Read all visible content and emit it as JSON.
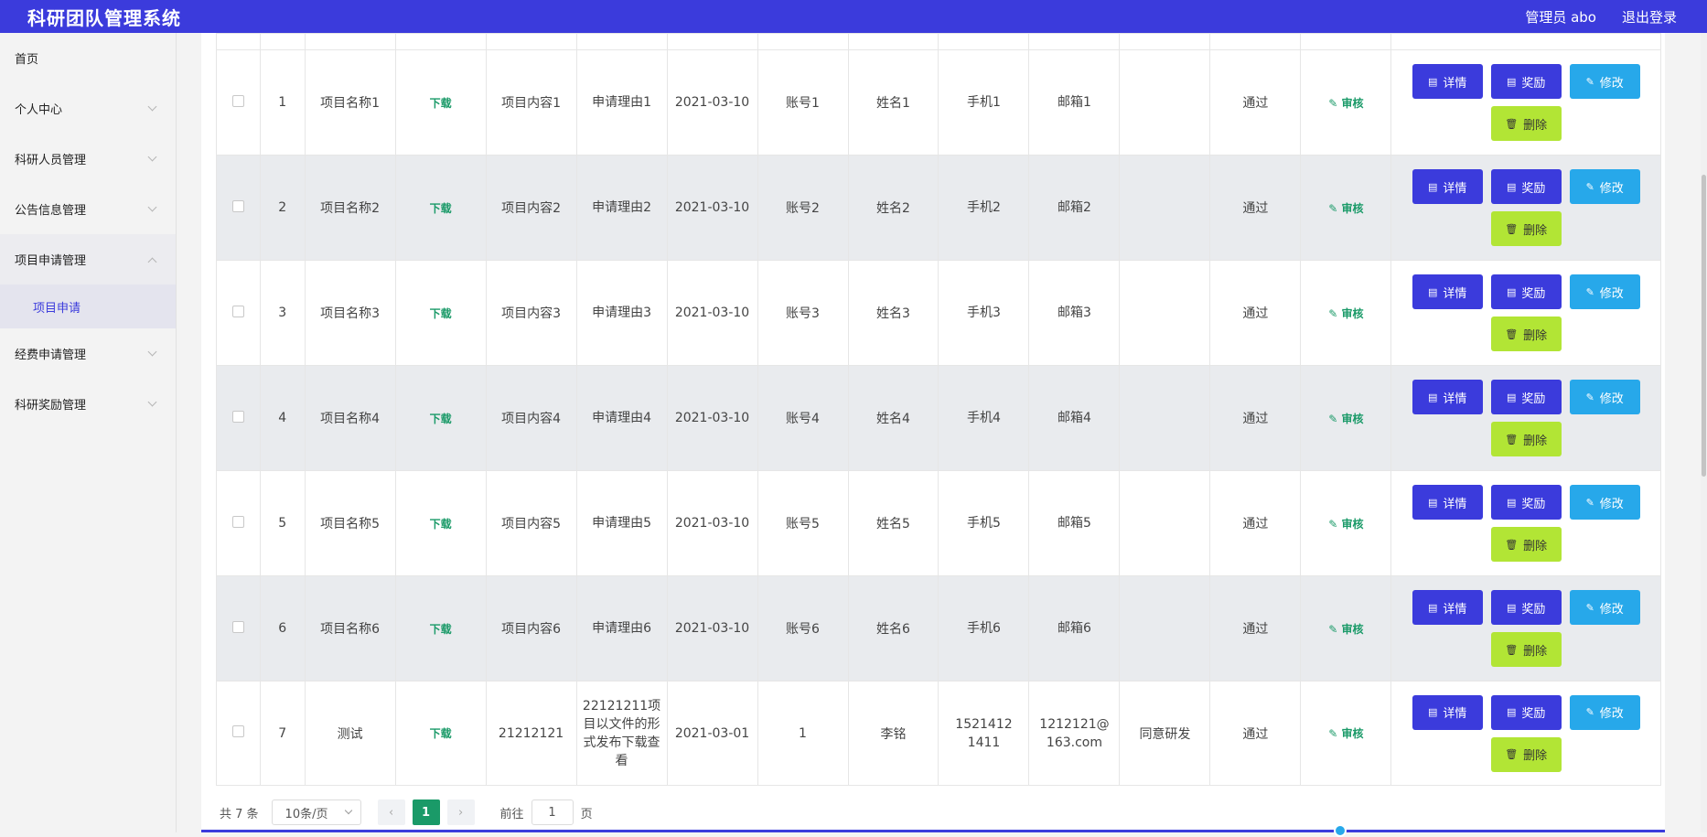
{
  "header": {
    "title": "科研团队管理系统",
    "user": "管理员 abo",
    "logout": "退出登录"
  },
  "sidebar": {
    "items": [
      {
        "label": "首页"
      },
      {
        "label": "个人中心"
      },
      {
        "label": "科研人员管理"
      },
      {
        "label": "公告信息管理"
      },
      {
        "label": "项目申请管理"
      },
      {
        "label": "经费申请管理"
      },
      {
        "label": "科研奖励管理"
      }
    ],
    "sub_item": "项目申请"
  },
  "labels": {
    "download": "下载",
    "audit": "审核",
    "detail": "详情",
    "reward": "奖励",
    "edit": "修改",
    "delete": "删除"
  },
  "rows": [
    {
      "idx": "1",
      "name": "项目名称1",
      "content": "项目内容1",
      "reason": "申请理由1",
      "date": "2021-03-10",
      "account": "账号1",
      "person": "姓名1",
      "phone": "手机1",
      "email": "邮箱1",
      "reply": "",
      "status": "通过"
    },
    {
      "idx": "2",
      "name": "项目名称2",
      "content": "项目内容2",
      "reason": "申请理由2",
      "date": "2021-03-10",
      "account": "账号2",
      "person": "姓名2",
      "phone": "手机2",
      "email": "邮箱2",
      "reply": "",
      "status": "通过"
    },
    {
      "idx": "3",
      "name": "项目名称3",
      "content": "项目内容3",
      "reason": "申请理由3",
      "date": "2021-03-10",
      "account": "账号3",
      "person": "姓名3",
      "phone": "手机3",
      "email": "邮箱3",
      "reply": "",
      "status": "通过"
    },
    {
      "idx": "4",
      "name": "项目名称4",
      "content": "项目内容4",
      "reason": "申请理由4",
      "date": "2021-03-10",
      "account": "账号4",
      "person": "姓名4",
      "phone": "手机4",
      "email": "邮箱4",
      "reply": "",
      "status": "通过"
    },
    {
      "idx": "5",
      "name": "项目名称5",
      "content": "项目内容5",
      "reason": "申请理由5",
      "date": "2021-03-10",
      "account": "账号5",
      "person": "姓名5",
      "phone": "手机5",
      "email": "邮箱5",
      "reply": "",
      "status": "通过"
    },
    {
      "idx": "6",
      "name": "项目名称6",
      "content": "项目内容6",
      "reason": "申请理由6",
      "date": "2021-03-10",
      "account": "账号6",
      "person": "姓名6",
      "phone": "手机6",
      "email": "邮箱6",
      "reply": "",
      "status": "通过"
    },
    {
      "idx": "7",
      "name": "测试",
      "content": "21212121",
      "reason": "22121211项目以文件的形式发布下载查看",
      "date": "2021-03-01",
      "account": "1",
      "person": "李铭",
      "phone": "15214121411",
      "email": "1212121@163.com",
      "reply": "同意研发",
      "status": "通过"
    }
  ],
  "pager": {
    "total": "共 7 条",
    "page_size": "10条/页",
    "current": "1",
    "goto_prefix": "前往",
    "goto_value": "1",
    "goto_suffix": "页"
  },
  "colors": {
    "primary": "#3b3bdc",
    "green": "#1a9a68",
    "edit": "#27a8ea",
    "delete": "#b2e535"
  }
}
